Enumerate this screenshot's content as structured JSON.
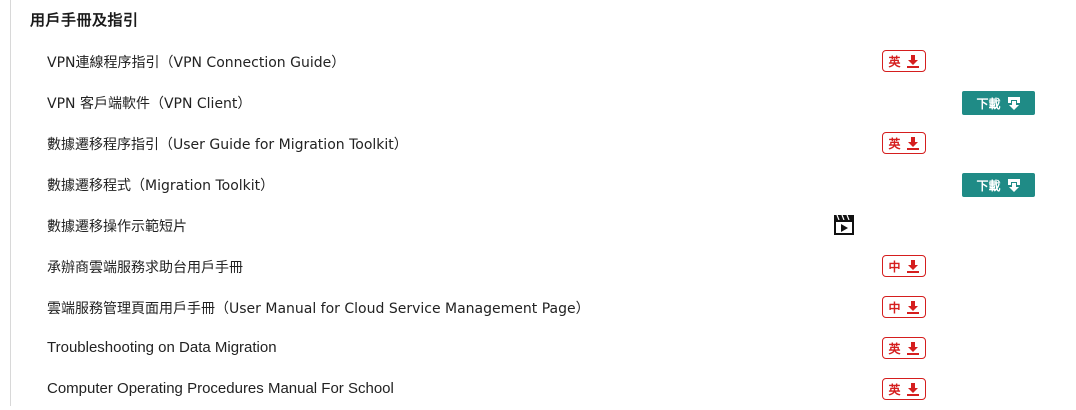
{
  "section": {
    "title": "用戶手冊及指引"
  },
  "rows": [
    {
      "title": "VPN連線程序指引（VPN Connection Guide）",
      "action": "badge",
      "action_label": "英"
    },
    {
      "title": "VPN 客戶端軟件（VPN Client）",
      "action": "button",
      "action_label": "下載"
    },
    {
      "title": "數據遷移程序指引（User Guide for Migration Toolkit）",
      "action": "badge",
      "action_label": "英"
    },
    {
      "title": "數據遷移程式（Migration Toolkit）",
      "action": "button",
      "action_label": "下載"
    },
    {
      "title": "數據遷移操作示範短片",
      "action": "video"
    },
    {
      "title": "承辦商雲端服務求助台用戶手冊",
      "action": "badge",
      "action_label": "中"
    },
    {
      "title": "雲端服務管理頁面用戶手冊（User Manual for Cloud Service Management Page）",
      "action": "badge",
      "action_label": "中"
    },
    {
      "title": "Troubleshooting on Data Migration",
      "action": "badge",
      "action_label": "英"
    },
    {
      "title": "Computer Operating Procedures Manual For School",
      "action": "badge",
      "action_label": "英"
    }
  ],
  "icons": {
    "badge_icon": "download-arrow-icon",
    "button_icon": "download-box-icon",
    "video_icon": "video-clapper-icon"
  },
  "colors": {
    "badge_red": "#d51e1e",
    "button_teal": "#1f8b86",
    "text": "#222222"
  }
}
